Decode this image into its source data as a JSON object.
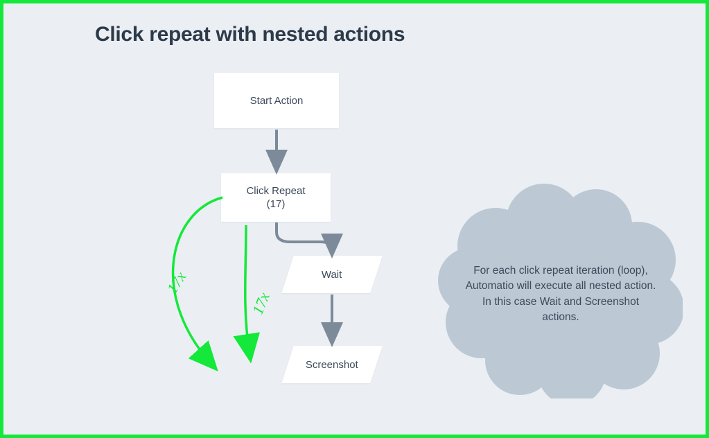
{
  "title": "Click repeat with nested actions",
  "nodes": {
    "start": "Start Action",
    "click_repeat_label": "Click Repeat",
    "click_repeat_count": "(17)",
    "wait": "Wait",
    "screenshot": "Screenshot"
  },
  "annotations": {
    "loop_left": "17x",
    "loop_right": "17x"
  },
  "callout": "For each click repeat iteration (loop), Automatio will execute all nested action. In this case Wait and Screenshot actions.",
  "colors": {
    "accent_green": "#14e83a",
    "arrow_gray": "#7c8a99",
    "cloud_gray": "#bcc8d4",
    "text_gray": "#3d4a5a",
    "bg": "#ebeff3"
  }
}
